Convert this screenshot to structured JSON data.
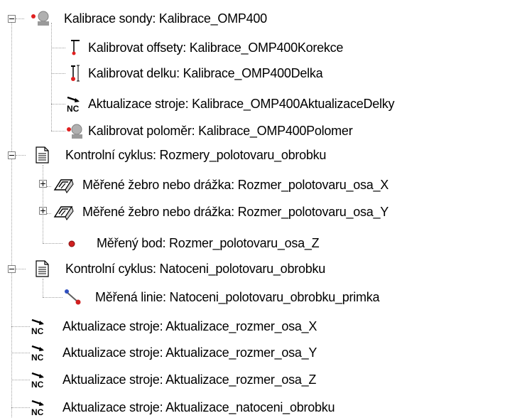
{
  "colors": {
    "connector": "#a0a0a0",
    "accent_red": "#e02020",
    "icon_grey": "#9a9a9a"
  },
  "tree": {
    "probe_calibration": {
      "icon": "probe-sphere-icon",
      "label": "Kalibrace sondy: Kalibrace_OMP400",
      "expanded": true,
      "children": [
        {
          "icon": "offset-calibration-icon",
          "label": "Kalibrovat offsety: Kalibrace_OMP400Korekce"
        },
        {
          "icon": "length-calibration-icon",
          "label": "Kalibrovat delku: Kalibrace_OMP400Delka"
        },
        {
          "icon": "nc-update-icon",
          "label": "Aktualizace stroje: Kalibrace_OMP400AktualizaceDelky"
        },
        {
          "icon": "probe-sphere-icon",
          "label": "Kalibrovat poloměr: Kalibrace_OMP400Polomer"
        }
      ]
    },
    "control_cycle_dimensions": {
      "icon": "document-icon",
      "label": "Kontrolní cyklus: Rozmery_polotovaru_obrobku",
      "expanded": true,
      "children": [
        {
          "icon": "rib-slot-icon",
          "label": "Měřené žebro nebo drážka: Rozmer_polotovaru_osa_X",
          "expanded": false
        },
        {
          "icon": "rib-slot-icon",
          "label": "Měřené žebro nebo drážka: Rozmer_polotovaru_osa_Y",
          "expanded": false
        },
        {
          "icon": "measured-point-icon",
          "label": "Měřený bod: Rozmer_polotovaru_osa_Z"
        }
      ]
    },
    "control_cycle_rotation": {
      "icon": "document-icon",
      "label": "Kontrolní cyklus: Natoceni_polotovaru_obrobku",
      "expanded": true,
      "children": [
        {
          "icon": "measured-line-icon",
          "label": "Měřená linie: Natoceni_polotovaru_obrobku_primka"
        }
      ]
    },
    "machine_updates": [
      {
        "icon": "nc-update-icon",
        "label": "Aktualizace stroje: Aktualizace_rozmer_osa_X"
      },
      {
        "icon": "nc-update-icon",
        "label": "Aktualizace stroje: Aktualizace_rozmer_osa_Y"
      },
      {
        "icon": "nc-update-icon",
        "label": "Aktualizace stroje: Aktualizace_rozmer_osa_Z"
      },
      {
        "icon": "nc-update-icon",
        "label": "Aktualizace stroje: Aktualizace_natoceni_obrobku"
      }
    ]
  }
}
